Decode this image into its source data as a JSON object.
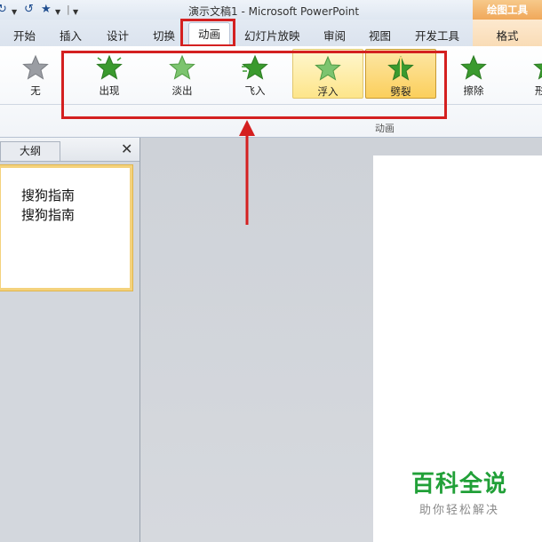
{
  "window": {
    "title": "演示文稿1 - Microsoft PowerPoint",
    "contextual_group": "绘图工具"
  },
  "quick_access": {
    "undo_icon": "undo-icon",
    "redo_icon": "redo-icon",
    "star_icon": "star-icon",
    "customize_icon": "customize-icon"
  },
  "tabs": [
    {
      "label": "开始"
    },
    {
      "label": "插入"
    },
    {
      "label": "设计"
    },
    {
      "label": "切换"
    },
    {
      "label": "动画"
    },
    {
      "label": "幻灯片放映"
    },
    {
      "label": "审阅"
    },
    {
      "label": "视图"
    },
    {
      "label": "开发工具"
    },
    {
      "label": "格式"
    }
  ],
  "ribbon": {
    "group_label": "动画",
    "effects": [
      {
        "label": "无",
        "icon": "star-gray-icon"
      },
      {
        "label": "出现",
        "icon": "star-green-icon"
      },
      {
        "label": "淡出",
        "icon": "star-green-icon"
      },
      {
        "label": "飞入",
        "icon": "star-green-icon"
      },
      {
        "label": "浮入",
        "icon": "star-green-icon"
      },
      {
        "label": "劈裂",
        "icon": "star-green-icon"
      },
      {
        "label": "擦除",
        "icon": "star-green-icon"
      },
      {
        "label": "形",
        "icon": "star-green-icon"
      }
    ]
  },
  "left_pane": {
    "tab_outline": "大纲",
    "close_symbol": "✕",
    "slide_lines": [
      "搜狗指南",
      "搜狗指南"
    ]
  },
  "watermark": {
    "main": "百科全说",
    "sub": "助你轻松解决"
  },
  "colors": {
    "annotation_red": "#d42020",
    "star_green": "#3a9a2e",
    "selected_effect": "#fbcf5c"
  }
}
